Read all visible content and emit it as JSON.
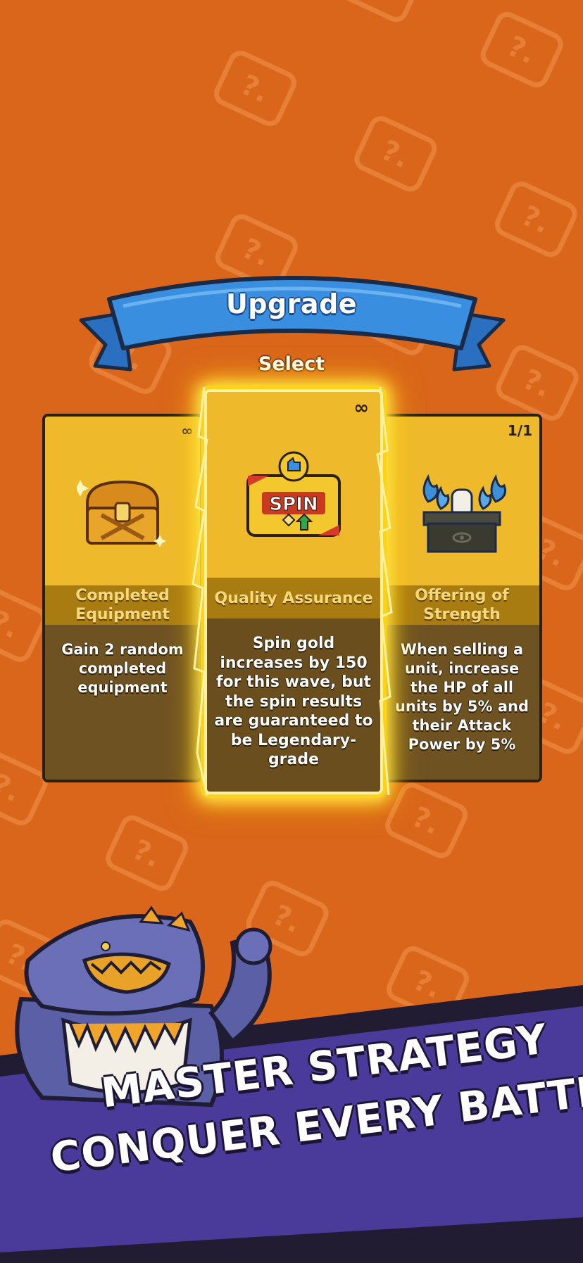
{
  "header": {
    "title": "Upgrade",
    "subtitle": "Select"
  },
  "cards": [
    {
      "name": "Completed Equipment",
      "description": "Gain 2 random completed equipment",
      "count": "∞",
      "icon": "treasure-chest-icon"
    },
    {
      "name": "Quality Assurance",
      "description": "Spin gold increases by 150 for this wave, but the spin results are guaranteed to be Legendary-grade",
      "count": "∞",
      "icon": "spin-ticket-icon",
      "icon_text": "SPIN",
      "selected": true
    },
    {
      "name": "Offering of Strength",
      "description": "When selling a unit, increase the HP of all units by 5% and their Attack Power by 5%",
      "count": "1/1",
      "icon": "altar-icon"
    }
  ],
  "banner": {
    "line1": "MASTER STRATEGY",
    "line2": "CONQUER EVERY BATTLE"
  },
  "colors": {
    "background": "#d9661a",
    "ribbon": "#3a8ee0",
    "card": "#eeba2c",
    "card_name_band": "#a97c12",
    "card_desc_area": "#6e5222",
    "banner": "#4a3a9a",
    "glow": "#ffe94a"
  }
}
